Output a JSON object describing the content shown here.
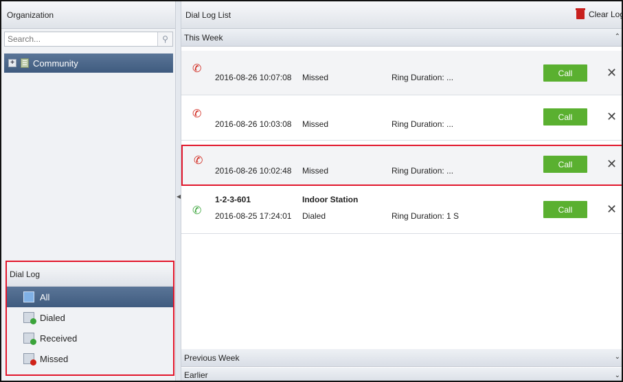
{
  "left": {
    "header": "Organization",
    "search_placeholder": "Search...",
    "tree_root": "Community",
    "dial_log": {
      "header": "Dial Log",
      "items": [
        {
          "label": "All",
          "icon": "list-icon",
          "active": true
        },
        {
          "label": "Dialed",
          "icon": "dialed-log-icon",
          "badge_color": "#3aa43a"
        },
        {
          "label": "Received",
          "icon": "received-log-icon",
          "badge_color": "#3aa43a"
        },
        {
          "label": "Missed",
          "icon": "missed-log-icon",
          "badge_color": "#d02318"
        }
      ]
    }
  },
  "right": {
    "header": "Dial Log List",
    "clear_label": "Clear Log",
    "sections": {
      "this_week": "This Week",
      "previous_week": "Previous Week",
      "earlier": "Earlier"
    },
    "entries": [
      {
        "name": "",
        "device": "",
        "datetime": "2016-08-26 10:07:08",
        "status": "Missed",
        "ring": "Ring Duration: ...",
        "type": "missed",
        "call": "Call"
      },
      {
        "name": "",
        "device": "",
        "datetime": "2016-08-26 10:03:08",
        "status": "Missed",
        "ring": "Ring Duration: ...",
        "type": "missed",
        "call": "Call"
      },
      {
        "name": "",
        "device": "",
        "datetime": "2016-08-26 10:02:48",
        "status": "Missed",
        "ring": "Ring Duration: ...",
        "type": "missed",
        "call": "Call",
        "selected": true
      },
      {
        "name": "1-2-3-601",
        "device": "Indoor Station",
        "datetime": "2016-08-25 17:24:01",
        "status": "Dialed",
        "ring": "Ring Duration: 1 S",
        "type": "dialed",
        "call": "Call"
      }
    ]
  },
  "colors": {
    "call_button": "#5ab030",
    "highlight_border": "#e2152a",
    "active_row": "#4a6689"
  }
}
